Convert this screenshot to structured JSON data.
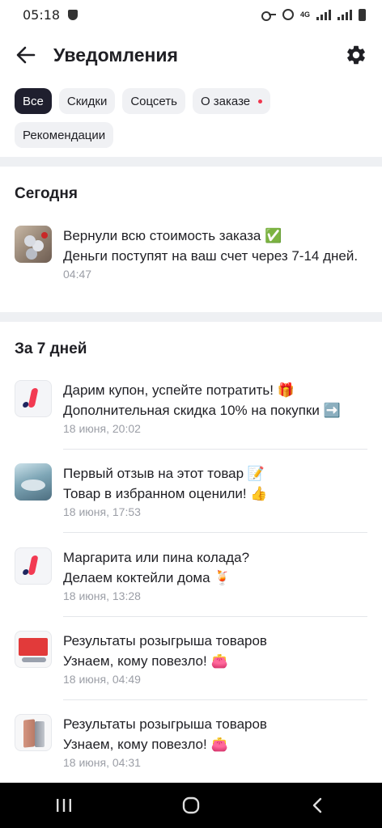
{
  "status_bar": {
    "time": "05:18",
    "network": "4G"
  },
  "header": {
    "title": "Уведомления"
  },
  "filters": [
    {
      "label": "Все",
      "active": true
    },
    {
      "label": "Скидки",
      "active": false
    },
    {
      "label": "Соцсеть",
      "active": false
    },
    {
      "label": "О заказе",
      "active": false,
      "unread_dot": true
    },
    {
      "label": "Рекомендации",
      "active": false
    }
  ],
  "sections": [
    {
      "title": "Сегодня",
      "items": [
        {
          "line1": "Вернули всю стоимость заказа ✅",
          "line2": "Деньги поступят на ваш счет через 7-14 дней.",
          "time": "04:47",
          "thumb": "product-photo"
        }
      ]
    },
    {
      "title": "За 7 дней",
      "items": [
        {
          "line1": "Дарим купон, успейте потратить! 🎁",
          "line2": "Дополнительная скидка 10% на покупки ➡️",
          "time": "18 июня, 20:02",
          "thumb": "brand-logo"
        },
        {
          "line1": "Первый отзыв на этот товар 📝",
          "line2": "Товар в избранном оценили! 👍",
          "time": "18 июня, 17:53",
          "thumb": "product-photo"
        },
        {
          "line1": "Маргарита или пина колада?",
          "line2": "Делаем коктейли дома 🍹",
          "time": "18 июня, 13:28",
          "thumb": "brand-logo"
        },
        {
          "line1": "Результаты розыгрыша товаров",
          "line2": "Узнаем, кому повезло! 👛",
          "time": "18 июня, 04:49",
          "thumb": "product-photo"
        },
        {
          "line1": "Результаты розыгрыша товаров",
          "line2": "Узнаем, кому повезло! 👛",
          "time": "18 июня, 04:31",
          "thumb": "product-photo"
        }
      ]
    }
  ],
  "icons": {
    "back": "arrow-left-icon",
    "settings": "gear-icon",
    "nav_recents": "recents-icon",
    "nav_home": "home-icon",
    "nav_back": "chevron-left-icon"
  },
  "colors": {
    "accent": "#f23a52",
    "chip_active_bg": "#1f1f2e",
    "chip_bg": "#f0f1f4",
    "muted_text": "#9b9ea6"
  }
}
